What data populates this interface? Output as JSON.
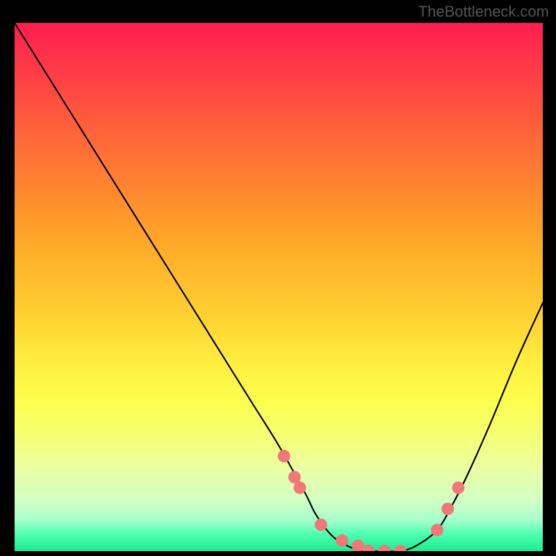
{
  "watermark": "TheBottleneck.com",
  "chart_data": {
    "type": "line",
    "title": "",
    "xlabel": "",
    "ylabel": "",
    "xlim": [
      0,
      100
    ],
    "ylim": [
      0,
      100
    ],
    "grid": false,
    "gradient_axis": "y",
    "gradient_stops": [
      {
        "pos": 0,
        "color": "#20e890",
        "meaning": "optimal"
      },
      {
        "pos": 3,
        "color": "#48ffb0"
      },
      {
        "pos": 6,
        "color": "#a8ffcc"
      },
      {
        "pos": 10,
        "color": "#d4ffc2"
      },
      {
        "pos": 16,
        "color": "#ebffa0"
      },
      {
        "pos": 22,
        "color": "#f6ff72"
      },
      {
        "pos": 28,
        "color": "#fcff4f"
      },
      {
        "pos": 35,
        "color": "#fff040"
      },
      {
        "pos": 45,
        "color": "#ffd030"
      },
      {
        "pos": 58,
        "color": "#ffaa28"
      },
      {
        "pos": 70,
        "color": "#ff8230"
      },
      {
        "pos": 82,
        "color": "#ff5a3c"
      },
      {
        "pos": 92,
        "color": "#ff3848"
      },
      {
        "pos": 100,
        "color": "#ff1e50",
        "meaning": "bottleneck"
      }
    ],
    "series": [
      {
        "name": "bottleneck-curve",
        "color": "#000000",
        "x": [
          0,
          5,
          10,
          15,
          20,
          25,
          30,
          35,
          40,
          45,
          50,
          55,
          57,
          60,
          63,
          66,
          70,
          73,
          76,
          80,
          83,
          86,
          90,
          95,
          100
        ],
        "y": [
          100,
          92,
          84,
          76,
          68,
          60,
          52,
          44,
          36,
          28,
          20,
          11,
          7,
          3,
          1,
          0,
          0,
          0,
          1,
          4,
          9,
          15,
          24,
          36,
          47
        ]
      }
    ],
    "markers": {
      "name": "highlighted-points",
      "color": "#f07878",
      "radius_px": 9,
      "points": [
        {
          "x": 51,
          "y": 18
        },
        {
          "x": 53,
          "y": 14
        },
        {
          "x": 54,
          "y": 12
        },
        {
          "x": 58,
          "y": 5
        },
        {
          "x": 62,
          "y": 2
        },
        {
          "x": 65,
          "y": 1
        },
        {
          "x": 67,
          "y": 0
        },
        {
          "x": 70,
          "y": 0
        },
        {
          "x": 73,
          "y": 0
        },
        {
          "x": 80,
          "y": 4
        },
        {
          "x": 82,
          "y": 8
        },
        {
          "x": 84,
          "y": 12
        }
      ]
    }
  }
}
